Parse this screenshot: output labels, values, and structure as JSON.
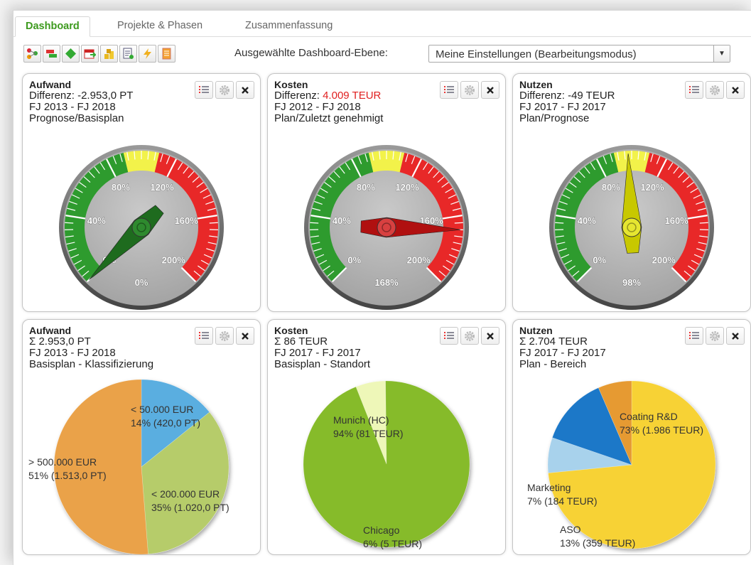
{
  "tabs": [
    {
      "label": "Dashboard",
      "active": true
    },
    {
      "label": "Projekte & Phasen",
      "active": false
    },
    {
      "label": "Zusammenfassung",
      "active": false
    }
  ],
  "toolbar": {
    "icons": [
      "hierarchy-icon",
      "bars-icon",
      "diamond-icon",
      "calendar-icon",
      "coins-icon",
      "report-icon",
      "lightning-icon",
      "document-icon"
    ],
    "level_label": "Ausgewählte Dashboard-Ebene:",
    "level_value": "Meine Einstellungen (Bearbeitungsmodus)"
  },
  "gauges": [
    {
      "title": "Aufwand",
      "diff_label": "Differenz: ",
      "diff_value": "-2.953,0 PT",
      "diff_color": "#222222",
      "range": "FJ 2013 - FJ 2018",
      "compare": "Prognose/Basisplan",
      "reading_pct": 0,
      "reading_label": "0%",
      "needle_color": "#1e6b1e",
      "hub_color": "#2e8a2e"
    },
    {
      "title": "Kosten",
      "diff_label": "Differenz: ",
      "diff_value": "4.009 TEUR",
      "diff_color": "#e02020",
      "range": "FJ 2012 - FJ 2018",
      "compare": "Plan/Zuletzt genehmigt",
      "reading_pct": 168,
      "reading_label": "168%",
      "needle_color": "#b01010",
      "hub_color": "#d84040"
    },
    {
      "title": "Nutzen",
      "diff_label": "Differenz: ",
      "diff_value": "-49 TEUR",
      "diff_color": "#222222",
      "range": "FJ 2017 - FJ 2017",
      "compare": "Plan/Prognose",
      "reading_pct": 98,
      "reading_label": "98%",
      "needle_color": "#c8c800",
      "hub_color": "#e6e630"
    }
  ],
  "gauge_scale": {
    "min": 0,
    "max": 200,
    "labels": [
      "0%",
      "40%",
      "80%",
      "120%",
      "160%",
      "200%"
    ],
    "green_to": 90,
    "yellow_to": 110,
    "colors": {
      "green": "#2e9b2e",
      "yellow": "#f2f24a",
      "red": "#e82828"
    }
  },
  "pies": [
    {
      "title": "Aufwand",
      "total": "Σ 2.953,0 PT",
      "range": "FJ 2013 - FJ 2018",
      "subtitle": "Basisplan - Klassifizierung",
      "chart_data": {
        "type": "pie",
        "slices": [
          {
            "label": "< 50.000 EUR",
            "value_label": "14% (420,0 PT)",
            "value": 420.0,
            "color": "#5aaee0"
          },
          {
            "label": "< 200.000 EUR",
            "value_label": "35% (1.020,0 PT)",
            "value": 1020.0,
            "color": "#b6cc6a"
          },
          {
            "label": "> 500.000 EUR",
            "value_label": "51% (1.513,0 PT)",
            "value": 1513.0,
            "color": "#eaa24a"
          }
        ]
      }
    },
    {
      "title": "Kosten",
      "total": "Σ 86 TEUR",
      "range": "FJ 2017 - FJ 2017",
      "subtitle": "Basisplan - Standort",
      "chart_data": {
        "type": "pie",
        "slices": [
          {
            "label": "Chicago",
            "value_label": "6% (5 TEUR)",
            "value": 5,
            "color": "#eef7b8"
          },
          {
            "label": "Munich (HC)",
            "value_label": "94% (81 TEUR)",
            "value": 81,
            "color": "#86bb2c"
          }
        ]
      }
    },
    {
      "title": "Nutzen",
      "total": "Σ 2.704 TEUR",
      "range": "FJ 2017 - FJ 2017",
      "subtitle": "Plan - Bereich",
      "chart_data": {
        "type": "pie",
        "slices": [
          {
            "label": "Coating R&D",
            "value_label": "73% (1.986 TEUR)",
            "value": 1986,
            "color": "#f7d234"
          },
          {
            "label": "Marketing",
            "value_label": "7% (184 TEUR)",
            "value": 184,
            "color": "#a8d2ec"
          },
          {
            "label": "ASO",
            "value_label": "13% (359 TEUR)",
            "value": 359,
            "color": "#1e78c8"
          },
          {
            "label": "",
            "value_label": "",
            "value": 175,
            "color": "#e69a30"
          }
        ]
      }
    }
  ]
}
